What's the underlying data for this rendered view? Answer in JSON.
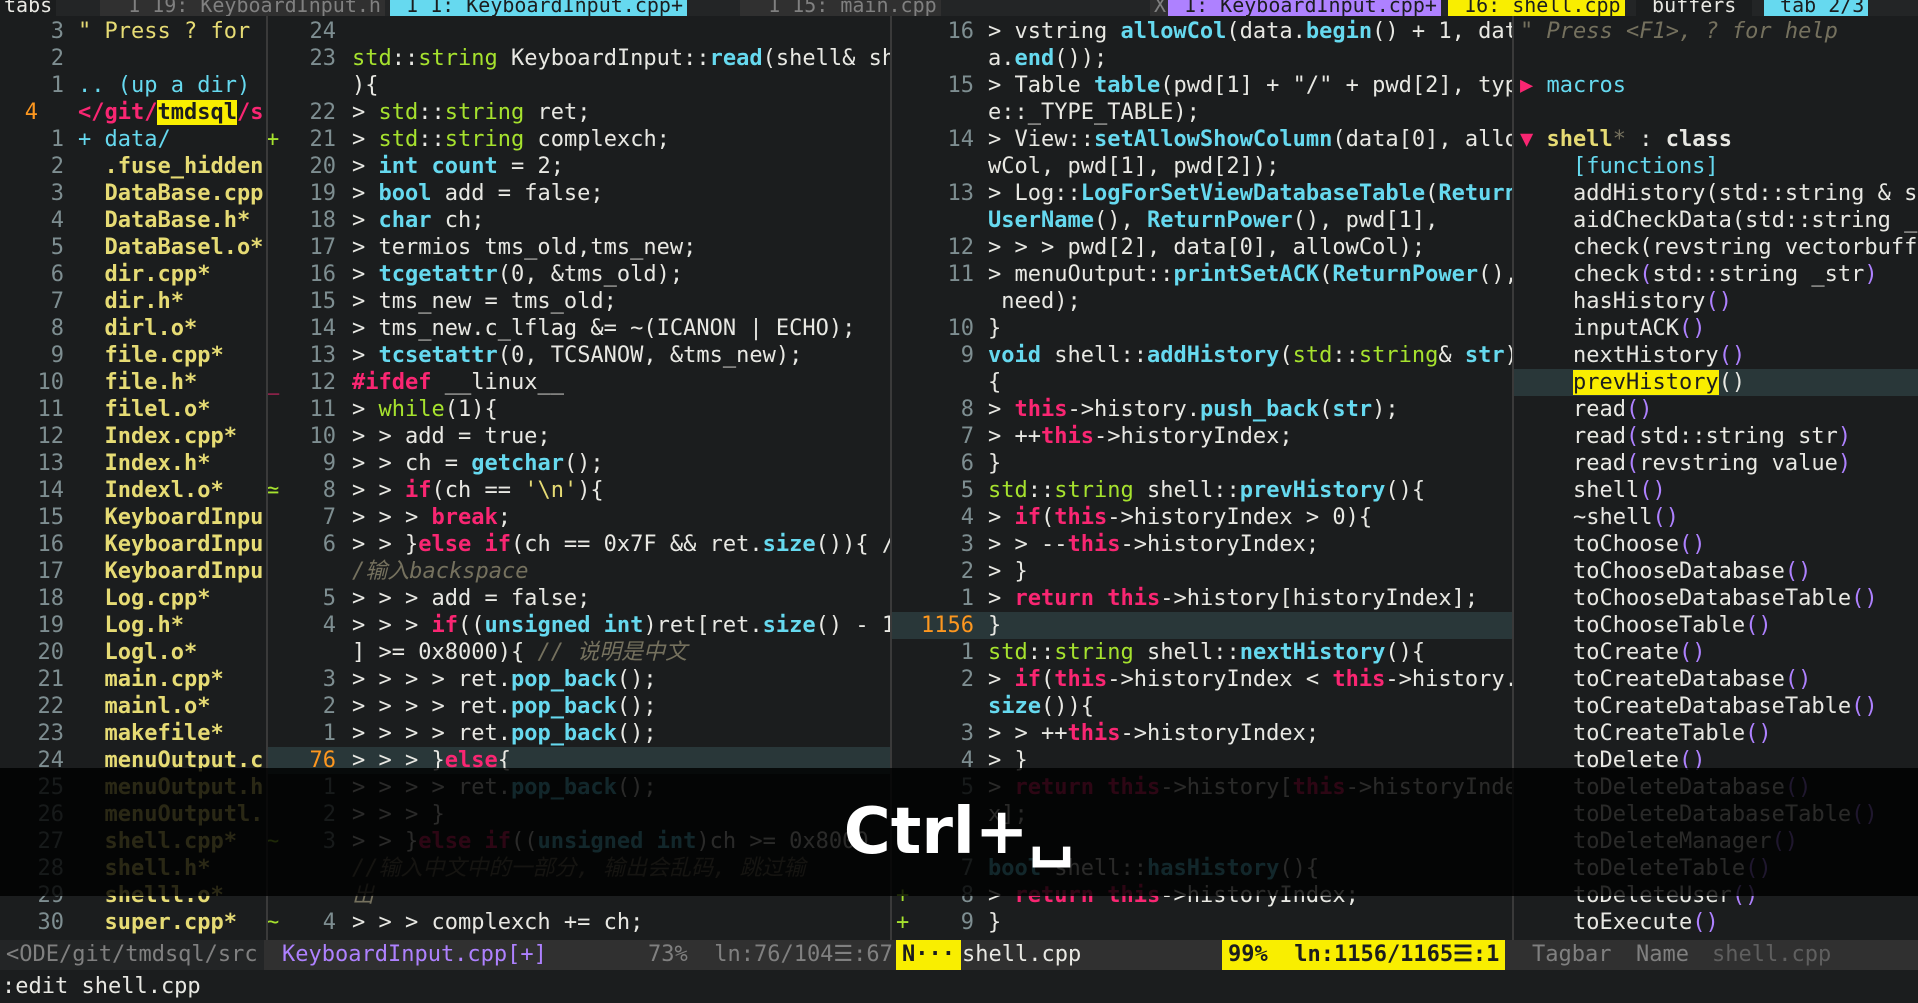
{
  "tabline": {
    "tabs": [
      {
        "label": "tabs",
        "style": "lbl"
      },
      {
        "label": "  1 19: KeyboardInput.h",
        "style": ""
      },
      {
        "label": " 1 1: KeyboardInput.cpp+",
        "style": "sel"
      },
      {
        "label": "  1 15: main.cpp",
        "style": ""
      },
      {
        "label": "X",
        "style": ""
      },
      {
        "label": " 1: KeyboardInput.cpp+",
        "style": "sel2"
      },
      {
        "label": " 16: shell.cpp",
        "style": "right1"
      },
      {
        "label": " buffers ",
        "style": "lbl"
      },
      {
        "label": " tab 2/3",
        "style": "right2"
      }
    ]
  },
  "filetree": {
    "header": "\" Press ? for",
    "header_num": "3",
    "lines": [
      {
        "n": "2",
        "t": "",
        "c": ""
      },
      {
        "n": "1",
        "t": ".. (up a dir)",
        "c": "dir"
      },
      {
        "n": "4",
        "t": "</git/tmdsql/s",
        "c": "cur"
      },
      {
        "n": "1",
        "t": "+ data/",
        "c": "dir"
      },
      {
        "n": "2",
        "t": "  .fuse_hidden",
        "c": "exe"
      },
      {
        "n": "3",
        "t": "  DataBase.cpp",
        "c": "exe"
      },
      {
        "n": "4",
        "t": "  DataBase.h*",
        "c": "exe"
      },
      {
        "n": "5",
        "t": "  DataBasel.o*",
        "c": "exe"
      },
      {
        "n": "6",
        "t": "  dir.cpp*",
        "c": "exe"
      },
      {
        "n": "7",
        "t": "  dir.h*",
        "c": "exe"
      },
      {
        "n": "8",
        "t": "  dirl.o*",
        "c": "exe"
      },
      {
        "n": "9",
        "t": "  file.cpp*",
        "c": "exe"
      },
      {
        "n": "10",
        "t": "  file.h*",
        "c": "exe"
      },
      {
        "n": "11",
        "t": "  filel.o*",
        "c": "exe"
      },
      {
        "n": "12",
        "t": "  Index.cpp*",
        "c": "exe"
      },
      {
        "n": "13",
        "t": "  Index.h*",
        "c": "exe"
      },
      {
        "n": "14",
        "t": "  Indexl.o*",
        "c": "exe"
      },
      {
        "n": "15",
        "t": "  KeyboardInpu",
        "c": "exe"
      },
      {
        "n": "16",
        "t": "  KeyboardInpu",
        "c": "exe"
      },
      {
        "n": "17",
        "t": "  KeyboardInpu",
        "c": "exe"
      },
      {
        "n": "18",
        "t": "  Log.cpp*",
        "c": "exe"
      },
      {
        "n": "19",
        "t": "  Log.h*",
        "c": "exe"
      },
      {
        "n": "20",
        "t": "  Logl.o*",
        "c": "exe"
      },
      {
        "n": "21",
        "t": "  main.cpp*",
        "c": "exe"
      },
      {
        "n": "22",
        "t": "  mainl.o*",
        "c": "exe"
      },
      {
        "n": "23",
        "t": "  makefile*",
        "c": "exe"
      },
      {
        "n": "24",
        "t": "  menuOutput.c",
        "c": "exe"
      },
      {
        "n": "25",
        "t": "  menuOutput.h",
        "c": "exe"
      },
      {
        "n": "26",
        "t": "  menuOutputl.",
        "c": "exe"
      },
      {
        "n": "27",
        "t": "  shell.cpp*",
        "c": "exe"
      },
      {
        "n": "28",
        "t": "  shell.h*",
        "c": "exe"
      },
      {
        "n": "29",
        "t": "  shelll.o*",
        "c": "exe"
      },
      {
        "n": "30",
        "t": "  super.cpp*",
        "c": "exe"
      }
    ]
  },
  "editor1": {
    "lines": [
      {
        "n": "24",
        "s": "",
        "h": ""
      },
      {
        "n": "23",
        "s": "",
        "h": "<span class='ty'>std</span>::<span class='ty'>string</span> KeyboardInput::<span class='fn'>read</span>(shell&amp; sh"
      },
      {
        "n": "",
        "s": "",
        "h": "){"
      },
      {
        "n": "22",
        "s": "",
        "h": "&gt; <span class='ty'>std</span>::<span class='ty'>string</span> ret;"
      },
      {
        "n": "21",
        "s": "+",
        "h": "&gt; <span class='ty'>std</span>::<span class='ty'>string</span> complexch;"
      },
      {
        "n": "20",
        "s": "",
        "h": "&gt; <span class='fn'>int</span> <span class='fn'>count</span> = 2;"
      },
      {
        "n": "19",
        "s": "",
        "h": "&gt; <span class='fn'>bool</span> add = false;"
      },
      {
        "n": "18",
        "s": "",
        "h": "&gt; <span class='fn'>char</span> ch;"
      },
      {
        "n": "17",
        "s": "",
        "h": "&gt; termios tms_old,tms_new;"
      },
      {
        "n": "16",
        "s": "",
        "h": "&gt; <span class='fn'>tcgetattr</span>(0, &amp;tms_old);"
      },
      {
        "n": "15",
        "s": "",
        "h": "&gt; tms_new = tms_old;"
      },
      {
        "n": "14",
        "s": "",
        "h": "&gt; tms_new.c_lflag &amp;= ~(ICANON | ECHO);"
      },
      {
        "n": "13",
        "s": "",
        "h": "&gt; <span class='fn'>tcsetattr</span>(0, TCSANOW, &amp;tms_new);"
      },
      {
        "n": "12",
        "s": "_",
        "h": "<span class='kw'>#ifdef</span> __linux__"
      },
      {
        "n": "11",
        "s": "",
        "h": "&gt; <span class='grn'>while</span>(1){"
      },
      {
        "n": "10",
        "s": "",
        "h": "&gt; &gt; add = true;"
      },
      {
        "n": "9",
        "s": "",
        "h": "&gt; &gt; ch = <span class='fn'>getchar</span>();"
      },
      {
        "n": "8",
        "s": "≃",
        "h": "&gt; &gt; <span class='kw'>if</span>(ch == <span class='str'>'\\n'</span>){"
      },
      {
        "n": "7",
        "s": "",
        "h": "&gt; &gt; &gt; <span class='kw'>break</span>;"
      },
      {
        "n": "6",
        "s": "",
        "h": "&gt; &gt; }<span class='kw'>else if</span>(ch == 0x7F &amp;&amp; ret.<span class='fn'>size</span>()){ /"
      },
      {
        "n": "",
        "s": "",
        "h": "<span class='cmt'>/输入backspace</span>"
      },
      {
        "n": "5",
        "s": "",
        "h": "&gt; &gt; &gt; add = false;"
      },
      {
        "n": "4",
        "s": "",
        "h": "&gt; &gt; &gt; <span class='kw'>if</span>((<span class='fn'>unsigned int</span>)ret[ret.<span class='fn'>size</span>() - 1"
      },
      {
        "n": "",
        "s": "",
        "h": "] &gt;= 0x8000){ <span class='cmt'>// 说明是中文</span>"
      },
      {
        "n": "3",
        "s": "",
        "h": "&gt; &gt; &gt; &gt; ret.<span class='fn'>pop_back</span>();"
      },
      {
        "n": "2",
        "s": "",
        "h": "&gt; &gt; &gt; &gt; ret.<span class='fn'>pop_back</span>();"
      },
      {
        "n": "1",
        "s": "",
        "h": "&gt; &gt; &gt; &gt; ret.<span class='fn'>pop_back</span>();"
      },
      {
        "n": "76",
        "s": "",
        "h": "&gt; &gt; &gt; }<span class='kw'>else</span>{",
        "cur": true
      },
      {
        "n": "1",
        "s": "",
        "h": "&gt; &gt; &gt; &gt; ret.<span class='fn'>pop_back</span>();"
      },
      {
        "n": "2",
        "s": "",
        "h": "&gt; &gt; &gt; }"
      },
      {
        "n": "3",
        "s": "~",
        "h": "&gt; &gt; }<span class='kw'>else if</span>((<span class='fn'>unsigned int</span>)ch &gt;= 0x8000"
      },
      {
        "n": "",
        "s": "",
        "h": "<span class='cmt'>//输入中文中的一部分, 输出会乱码, 跳过输</span>"
      },
      {
        "n": "",
        "s": "",
        "h": "<span class='cmt'>出</span>"
      },
      {
        "n": "4",
        "s": "~",
        "h": "&gt; &gt; &gt; complexch += ch;"
      }
    ]
  },
  "editor2": {
    "lines": [
      {
        "n": "16",
        "s": "",
        "h": "&gt; vstring <span class='fn'>allowCol</span>(data.<span class='fn'>begin</span>() + 1, dat"
      },
      {
        "n": "",
        "s": "",
        "h": "a.<span class='fn'>end</span>());"
      },
      {
        "n": "15",
        "s": "",
        "h": "&gt; Table <span class='fn'>table</span>(pwd[1] + \"/\" + pwd[2], typ"
      },
      {
        "n": "",
        "s": "",
        "h": "e::_TYPE_TABLE);"
      },
      {
        "n": "14",
        "s": "",
        "h": "&gt; View::<span class='fn'>setAllowShowColumn</span>(data[0], allo"
      },
      {
        "n": "",
        "s": "",
        "h": "wCol, pwd[1], pwd[2]);"
      },
      {
        "n": "13",
        "s": "",
        "h": "&gt; Log::<span class='fn'>LogForSetViewDatabaseTable</span>(<span class='fn'>Return</span>"
      },
      {
        "n": "",
        "s": "",
        "h": "<span class='fn'>UserName</span>(), <span class='fn'>ReturnPower</span>(), pwd[1],"
      },
      {
        "n": "12",
        "s": "",
        "h": "&gt; &gt; &gt; pwd[2], data[0], allowCol);"
      },
      {
        "n": "11",
        "s": "",
        "h": "&gt; menuOutput::<span class='fn'>printSetACK</span>(<span class='fn'>ReturnPower</span>(),"
      },
      {
        "n": "",
        "s": "",
        "h": " need);"
      },
      {
        "n": "10",
        "s": "",
        "h": "}"
      },
      {
        "n": "9",
        "s": "",
        "h": "<span class='fn'>void</span> shell::<span class='fn'>addHistory</span>(<span class='ty'>std</span>::<span class='ty'>string</span>&amp; <span class='fn'>str</span>)"
      },
      {
        "n": "",
        "s": "",
        "h": "{"
      },
      {
        "n": "8",
        "s": "",
        "h": "&gt; <span class='kw'>this</span>-&gt;history.<span class='fn'>push_back</span>(<span class='fn'>str</span>);"
      },
      {
        "n": "7",
        "s": "",
        "h": "&gt; ++<span class='kw'>this</span>-&gt;historyIndex;"
      },
      {
        "n": "6",
        "s": "",
        "h": "}"
      },
      {
        "n": "5",
        "s": "",
        "h": "<span class='ty'>std</span>::<span class='ty'>string</span> shell::<span class='fn'>prevHistory</span>(){"
      },
      {
        "n": "4",
        "s": "",
        "h": "&gt; <span class='kw'>if</span>(<span class='kw'>this</span>-&gt;historyIndex &gt; 0){"
      },
      {
        "n": "3",
        "s": "",
        "h": "&gt; &gt; --<span class='kw'>this</span>-&gt;historyIndex;"
      },
      {
        "n": "2",
        "s": "",
        "h": "&gt; }"
      },
      {
        "n": "1",
        "s": "",
        "h": "&gt; <span class='kw'>return</span> <span class='kw'>this</span>-&gt;history[historyIndex];"
      },
      {
        "n": "1156",
        "s": "",
        "h": "}",
        "cur": true
      },
      {
        "n": "1",
        "s": "",
        "h": "<span class='ty'>std</span>::<span class='ty'>string</span> shell::<span class='fn'>nextHistory</span>(){"
      },
      {
        "n": "2",
        "s": "",
        "h": "&gt; <span class='kw'>if</span>(<span class='kw'>this</span>-&gt;historyIndex &lt; <span class='kw'>this</span>-&gt;history."
      },
      {
        "n": "",
        "s": "",
        "h": "<span class='fn'>size</span>()){"
      },
      {
        "n": "3",
        "s": "",
        "h": "&gt; &gt; ++<span class='kw'>this</span>-&gt;historyIndex;"
      },
      {
        "n": "4",
        "s": "",
        "h": "&gt; }"
      },
      {
        "n": "5",
        "s": "",
        "h": "&gt; <span class='kw'>return</span> <span class='kw'>this</span>-&gt;history[<span class='kw'>this</span>-&gt;historyInde"
      },
      {
        "n": "",
        "s": "",
        "h": "x];"
      },
      {
        "n": "",
        "s": "",
        "h": ""
      },
      {
        "n": "7",
        "s": "",
        "h": "<span class='fn'>bool</span> shell::<span class='fn'>hasHistory</span>(){"
      },
      {
        "n": "8",
        "s": "+",
        "h": "&gt; <span class='kw'>return</span> <span class='kw'>this</span>-&gt;historyIndex;"
      },
      {
        "n": "9",
        "s": "+",
        "h": "}"
      }
    ]
  },
  "tagbar": {
    "header": "\" Press <F1>, ? for help",
    "lines": [
      {
        "t": "",
        "c": ""
      },
      {
        "t": "▶ macros",
        "c": "dir"
      },
      {
        "t": "",
        "c": ""
      },
      {
        "t": "▼ shell* : class",
        "c": "cls"
      },
      {
        "t": "    [functions]",
        "c": "dir"
      },
      {
        "t": "    addHistory(std::string & s",
        "c": ""
      },
      {
        "t": "    aidCheckData(std::string _",
        "c": ""
      },
      {
        "t": "    check(revstring vectorbuff",
        "c": ""
      },
      {
        "t": "    check(std::string _str)",
        "c": ""
      },
      {
        "t": "    hasHistory()",
        "c": ""
      },
      {
        "t": "    inputACK()",
        "c": ""
      },
      {
        "t": "    nextHistory()",
        "c": ""
      },
      {
        "t": "    prevHistory()",
        "c": "hl"
      },
      {
        "t": "    read()",
        "c": ""
      },
      {
        "t": "    read(std::string str)",
        "c": ""
      },
      {
        "t": "    read(revstring value)",
        "c": ""
      },
      {
        "t": "    shell()",
        "c": ""
      },
      {
        "t": "    ~shell()",
        "c": ""
      },
      {
        "t": "    toChoose()",
        "c": ""
      },
      {
        "t": "    toChooseDatabase()",
        "c": ""
      },
      {
        "t": "    toChooseDatabaseTable()",
        "c": ""
      },
      {
        "t": "    toChooseTable()",
        "c": ""
      },
      {
        "t": "    toCreate()",
        "c": ""
      },
      {
        "t": "    toCreateDatabase()",
        "c": ""
      },
      {
        "t": "    toCreateDatabaseTable()",
        "c": ""
      },
      {
        "t": "    toCreateTable()",
        "c": ""
      },
      {
        "t": "    toDelete()",
        "c": ""
      },
      {
        "t": "    toDeleteDatabase()",
        "c": ""
      },
      {
        "t": "    toDeleteDatabaseTable()",
        "c": ""
      },
      {
        "t": "    toDeleteManager()",
        "c": ""
      },
      {
        "t": "    toDeleteTable()",
        "c": ""
      },
      {
        "t": "    toDeleteUser()",
        "c": ""
      },
      {
        "t": "    toExecute()",
        "c": ""
      }
    ]
  },
  "statusline": {
    "left_path": "<ODE/git/tmdsql/src",
    "file1": "KeyboardInput.cpp[+]",
    "pos1": "73%  ln:76/104☰:67",
    "mode": "N···",
    "file2": "shell.cpp",
    "pos2": "99%  ln:1156/1165☰:1",
    "tagbar_label": "Tagbar",
    "tagbar_name": "Name",
    "tagbar_file": "shell.cpp"
  },
  "cmdline": ":edit shell.cpp",
  "overlay_text": "Ctrl+␣"
}
